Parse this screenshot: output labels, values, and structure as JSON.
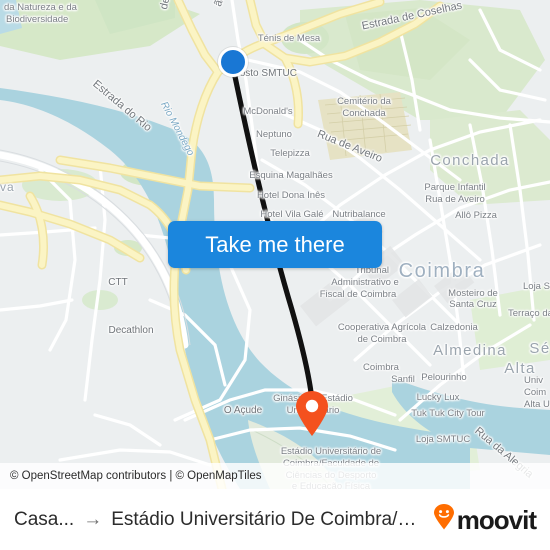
{
  "map": {
    "attribution": "© OpenStreetMap contributors | © OpenMapTiles",
    "cta": {
      "label": "Take me there"
    },
    "origin": {
      "name": "Posto SMTUC"
    },
    "destination": {
      "name": "Estádio Universitário de Coimbra/Faculdade de Ciências do Desporto e Educação Física"
    },
    "colors": {
      "route_line": "#111111",
      "origin_dot": "#1977d4",
      "destination_pin": "#f4511e",
      "cta_button": "#1b86dd",
      "water": "#aad3df",
      "park": "#cfe5c4",
      "road_major": "#f8ea9a",
      "land": "#eceff0",
      "brand_orange": "#ff6d00"
    },
    "labels": [
      {
        "text": "da Natureza e da",
        "kind": "poi"
      },
      {
        "text": "Biodiversidade",
        "kind": "poi"
      },
      {
        "text": "Estrada do Rio",
        "kind": "road"
      },
      {
        "text": "Rio Mondego",
        "kind": "water"
      },
      {
        "text": "de Aemínium",
        "kind": "road"
      },
      {
        "text": "ão",
        "kind": "road"
      },
      {
        "text": "Ténis de Mesa",
        "kind": "poi"
      },
      {
        "text": "Estrada de Coselhas",
        "kind": "road"
      },
      {
        "text": "Posto SMTUC",
        "kind": "poi2"
      },
      {
        "text": "McDonald's",
        "kind": "poi"
      },
      {
        "text": "Neptuno",
        "kind": "poi"
      },
      {
        "text": "Telepizza",
        "kind": "poi"
      },
      {
        "text": "Esquina Magalhães",
        "kind": "poi"
      },
      {
        "text": "Hotel Dona Inês",
        "kind": "poi"
      },
      {
        "text": "Hotel Vila Galé",
        "kind": "poi"
      },
      {
        "text": "Nutribalance",
        "kind": "poi"
      },
      {
        "text": "Cemitério da",
        "kind": "poi"
      },
      {
        "text": "Conchada",
        "kind": "poi"
      },
      {
        "text": "Rua de Aveiro",
        "kind": "road"
      },
      {
        "text": "Conchada",
        "kind": "area"
      },
      {
        "text": "Parque Infantil",
        "kind": "poi"
      },
      {
        "text": "Rua de Aveiro",
        "kind": "poi"
      },
      {
        "text": "Allô Pizza",
        "kind": "poi"
      },
      {
        "text": "Coimbra",
        "kind": "city"
      },
      {
        "text": "Mosteiro de",
        "kind": "poi"
      },
      {
        "text": "Santa Cruz",
        "kind": "poi"
      },
      {
        "text": "Loja SM",
        "kind": "poi"
      },
      {
        "text": "Terraço da",
        "kind": "poi"
      },
      {
        "text": "Tribunal",
        "kind": "poi"
      },
      {
        "text": "Administrativo e",
        "kind": "poi"
      },
      {
        "text": "Fiscal de Coimbra",
        "kind": "poi"
      },
      {
        "text": "Cooperativa Agrícola",
        "kind": "poi"
      },
      {
        "text": "de Coimbra",
        "kind": "poi"
      },
      {
        "text": "Calzedonia",
        "kind": "poi"
      },
      {
        "text": "Almedina",
        "kind": "area"
      },
      {
        "text": "Sé",
        "kind": "area"
      },
      {
        "text": "Alta",
        "kind": "area"
      },
      {
        "text": "Coimbra",
        "kind": "poi"
      },
      {
        "text": "Sanfil",
        "kind": "poi"
      },
      {
        "text": "Pelourinho",
        "kind": "poi"
      },
      {
        "text": "Lucky Lux",
        "kind": "poi"
      },
      {
        "text": "Tuk Tuk City Tour",
        "kind": "poi"
      },
      {
        "text": "Loja SMTUC",
        "kind": "poi"
      },
      {
        "text": "Rua da Alegria",
        "kind": "road"
      },
      {
        "text": "Univ",
        "kind": "poi"
      },
      {
        "text": "Coim",
        "kind": "poi"
      },
      {
        "text": "Alta U",
        "kind": "poi"
      },
      {
        "text": "CTT",
        "kind": "poi2"
      },
      {
        "text": "Decathlon",
        "kind": "poi2"
      },
      {
        "text": "O Açude",
        "kind": "poi2"
      },
      {
        "text": "Ginásio do Estádio",
        "kind": "poi"
      },
      {
        "text": "Universitário",
        "kind": "poi"
      },
      {
        "text": "Estádio Universitário de",
        "kind": "poi"
      },
      {
        "text": "Coimbra/Faculdade de",
        "kind": "poi"
      },
      {
        "text": "Ciências do Desporto",
        "kind": "poi"
      },
      {
        "text": "e Educação Física",
        "kind": "poi"
      },
      {
        "text": "va",
        "kind": "area-sm"
      }
    ]
  },
  "bottom_bar": {
    "from": "Casa...",
    "arrow": "→",
    "to": "Estádio Universitário De Coimbra/Faculda...",
    "brand": "moovit"
  }
}
